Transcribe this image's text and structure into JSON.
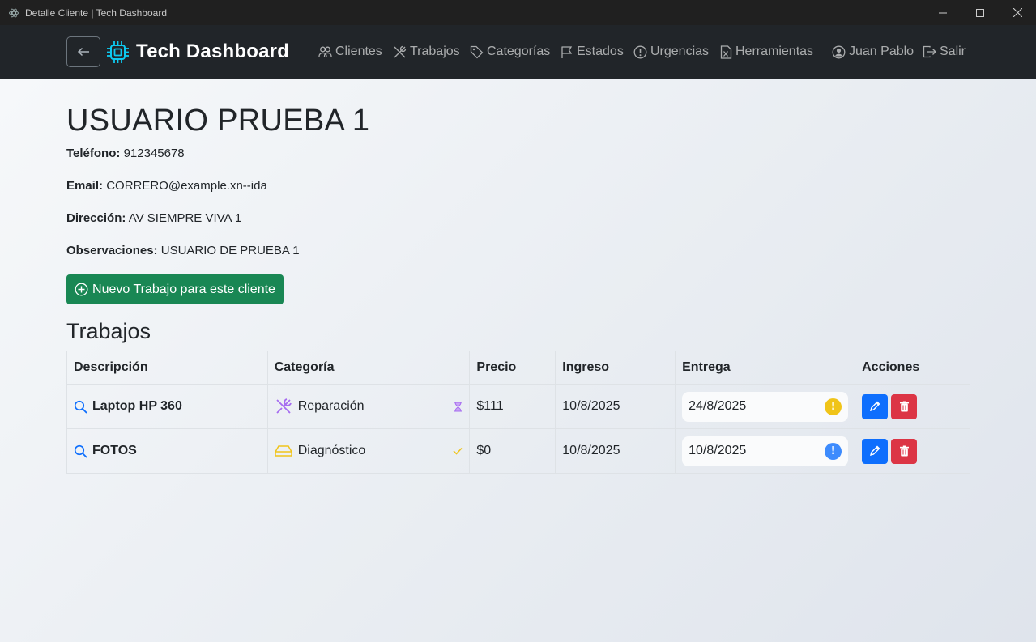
{
  "window": {
    "title": "Detalle Cliente | Tech Dashboard"
  },
  "navbar": {
    "brand": "Tech Dashboard",
    "items": [
      {
        "label": "Clientes",
        "icon": "people-icon"
      },
      {
        "label": "Trabajos",
        "icon": "tools-icon"
      },
      {
        "label": "Categorías",
        "icon": "tag-icon"
      },
      {
        "label": "Estados",
        "icon": "flag-icon"
      },
      {
        "label": "Urgencias",
        "icon": "exclamation-circle-icon"
      },
      {
        "label": "Herramientas",
        "icon": "file-excel-icon"
      }
    ],
    "user": "Juan Pablo",
    "logout": "Salir"
  },
  "client": {
    "name": "USUARIO PRUEBA 1",
    "fields": [
      {
        "label": "Teléfono:",
        "value": "912345678"
      },
      {
        "label": "Email:",
        "value": "CORRERO@example.xn--ida"
      },
      {
        "label": "Dirección:",
        "value": "AV SIEMPRE VIVA 1"
      },
      {
        "label": "Observaciones:",
        "value": "USUARIO DE PRUEBA 1"
      }
    ],
    "new_job_label": "Nuevo Trabajo para este cliente"
  },
  "jobs": {
    "title": "Trabajos",
    "columns": [
      "Descripción",
      "Categoría",
      "Precio",
      "Ingreso",
      "Entrega",
      "Acciones"
    ],
    "rows": [
      {
        "description": "Laptop HP 360",
        "category": "Reparación",
        "category_icon": "tools-icon",
        "status_icon": "hourglass-icon",
        "price": "$111",
        "ingreso": "10/8/2025",
        "entrega": "24/8/2025",
        "urgency_icon": "exclamation-circle-icon",
        "urgency_color": "#f0c419"
      },
      {
        "description": "FOTOS",
        "category": "Diagnóstico",
        "category_icon": "hdd-icon",
        "status_icon": "check-icon",
        "price": "$0",
        "ingreso": "10/8/2025",
        "entrega": "10/8/2025",
        "urgency_icon": "exclamation-circle-icon",
        "urgency_color": "#3d8bfd"
      }
    ]
  },
  "colors": {
    "navbar": "#212529",
    "success": "#198754",
    "primary": "#0d6efd",
    "danger": "#dc3545",
    "brand_icon": "#0dcaf0"
  }
}
